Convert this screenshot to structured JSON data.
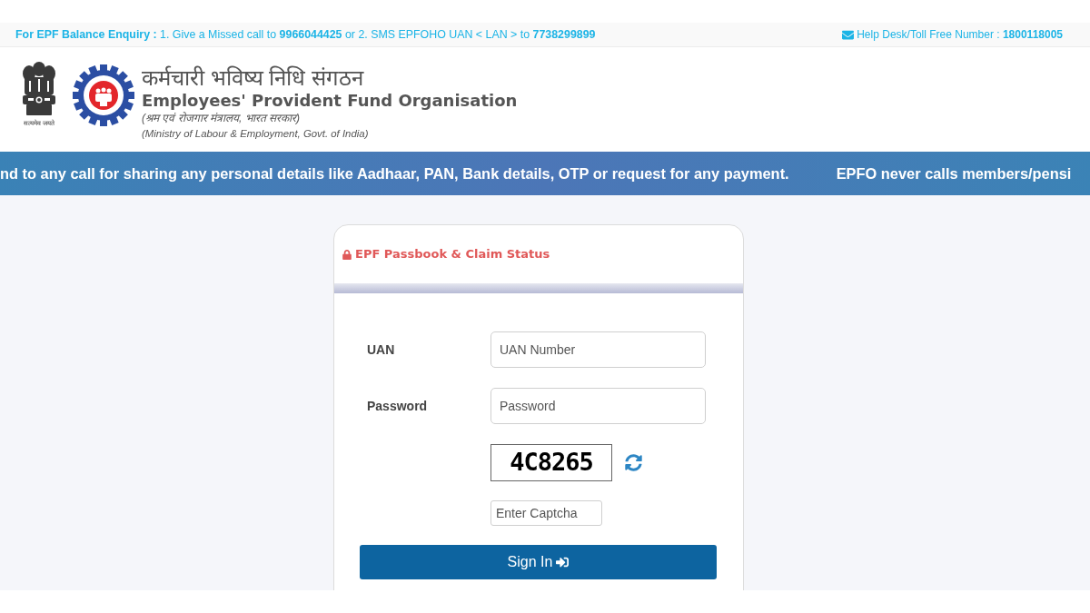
{
  "top_bar": {
    "enquiry": "**For EPF Balance Enquiry :** 1. Give a Missed call to **9966044425** or 2. SMS EPFOHO UAN < LAN > to **7738299899**",
    "helpdesk": "Help Desk/Toll Free Number : **1800118005**"
  },
  "header": {
    "emblem_motto": "सत्यमेव जयते",
    "title_hindi": "कर्मचारी भविष्य निधि संगठन",
    "title": "Employees' Provident Fund Organisation",
    "ministry_hindi": "(श्रम एवं रोजगार मंत्रालय, भारत सरकार)",
    "ministry": "(Ministry of Labour & Employment, Govt. of India)"
  },
  "alert_ticker": [
    "nd to any call for sharing any personal details like Aadhaar, PAN, Bank details, OTP or request for any payment.",
    "EPFO never calls members/pensi"
  ],
  "login_card": {
    "title": "EPF Passbook & Claim Status",
    "fields": [
      {
        "label": "UAN",
        "placeholder": "UAN Number"
      },
      {
        "label": "Password",
        "placeholder": "Password"
      }
    ],
    "captcha": {
      "code": "4C8265",
      "placeholder": "Enter Captcha"
    },
    "submit": "Sign In"
  }
}
